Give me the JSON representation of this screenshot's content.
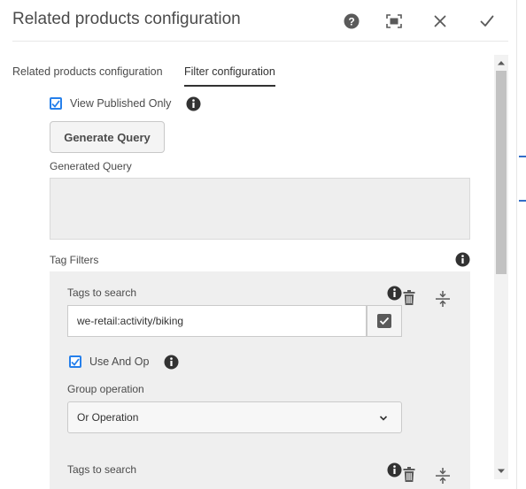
{
  "dialog": {
    "title": "Related products configuration"
  },
  "header": {
    "help_icon": "help-icon",
    "fullscreen_icon": "fullscreen-icon",
    "close_icon": "close-icon",
    "done_icon": "checkmark-icon"
  },
  "tabs": [
    {
      "label": "Related products configuration",
      "active": false
    },
    {
      "label": "Filter configuration",
      "active": true
    }
  ],
  "filter": {
    "view_published_only": {
      "label": "View Published Only",
      "checked": true
    },
    "generate_button": "Generate Query",
    "generated_query_label": "Generated Query",
    "generated_query_value": "",
    "tag_filters_label": "Tag Filters"
  },
  "tag_items": [
    {
      "tags_label": "Tags to search",
      "tags_value": "we-retail:activity/biking",
      "use_and_op": {
        "label": "Use And Op",
        "checked": true
      },
      "group_operation_label": "Group operation",
      "group_operation_value": "Or Operation"
    },
    {
      "tags_label": "Tags to search"
    }
  ],
  "colors": {
    "accent": "#2680eb",
    "text": "#4b4b4b",
    "panel": "#efefef"
  }
}
